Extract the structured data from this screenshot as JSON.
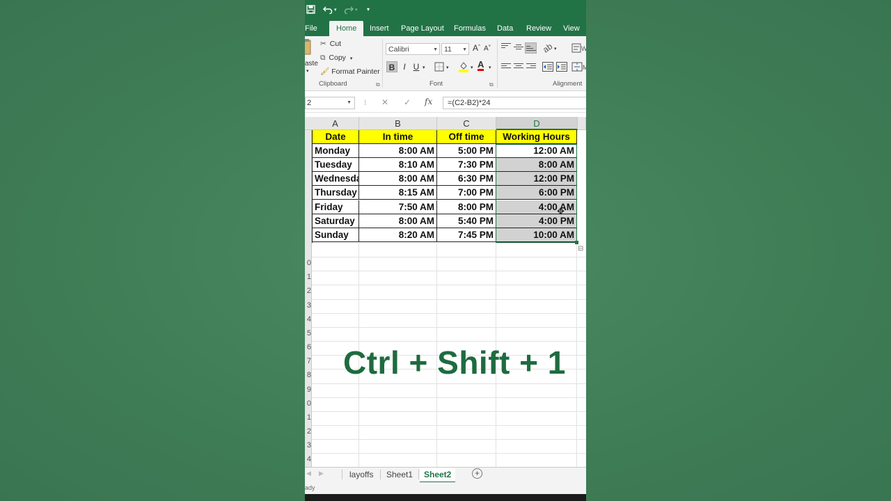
{
  "qat": {
    "save_icon": "save-icon",
    "undo_icon": "undo-icon",
    "redo_icon": "redo-icon",
    "customize_icon": "customize-qat-icon"
  },
  "tabs": [
    {
      "label": "File"
    },
    {
      "label": "Home",
      "active": true
    },
    {
      "label": "Insert"
    },
    {
      "label": "Page Layout"
    },
    {
      "label": "Formulas"
    },
    {
      "label": "Data"
    },
    {
      "label": "Review"
    },
    {
      "label": "View"
    }
  ],
  "ribbon": {
    "clipboard": {
      "paste": "aste",
      "cut": "Cut",
      "copy": "Copy",
      "format_painter": "Format Painter",
      "group_label": "Clipboard"
    },
    "font": {
      "font_name": "Calibri",
      "font_size": "11",
      "bold": "B",
      "italic": "I",
      "underline": "U",
      "font_color_letter": "A",
      "group_label": "Font"
    },
    "alignment": {
      "group_label": "Alignment"
    }
  },
  "formula_bar": {
    "name_box": "2",
    "cancel": "✕",
    "enter": "✓",
    "fx": "fx",
    "formula": "=(C2-B2)*24"
  },
  "columns": [
    "A",
    "B",
    "C",
    "D"
  ],
  "table": {
    "headers": [
      "Date",
      "In time",
      "Off time",
      "Working Hours"
    ],
    "rows": [
      [
        "Monday",
        "8:00 AM",
        "5:00 PM",
        "12:00 AM"
      ],
      [
        "Tuesday",
        "8:10 AM",
        "7:30 PM",
        "8:00 AM"
      ],
      [
        "Wednesday",
        "8:00 AM",
        "6:30 PM",
        "12:00 PM"
      ],
      [
        "Thursday",
        "8:15 AM",
        "7:00 PM",
        "6:00 PM"
      ],
      [
        "Friday",
        "7:50 AM",
        "8:00 PM",
        "4:00 AM"
      ],
      [
        "Saturday",
        "8:00 AM",
        "5:40 PM",
        "4:00 PM"
      ],
      [
        "Sunday",
        "8:20 AM",
        "7:45 PM",
        "10:00 AM"
      ]
    ]
  },
  "row_numbers": [
    "0",
    "1",
    "2",
    "3",
    "4",
    "5",
    "6",
    "7",
    "8",
    "9",
    "0",
    "1",
    "2",
    "3",
    "4"
  ],
  "overlay_text": "Ctrl + Shift + 1",
  "sheets": [
    {
      "label": "layoffs"
    },
    {
      "label": "Sheet1"
    },
    {
      "label": "Sheet2",
      "active": true
    }
  ],
  "add_sheet": "+",
  "status": "ady",
  "colors": {
    "excel_green": "#217346",
    "header_fill": "#ffff00",
    "selection_gray": "#d2d2d2",
    "overlay_text": "#1e6b3f"
  }
}
